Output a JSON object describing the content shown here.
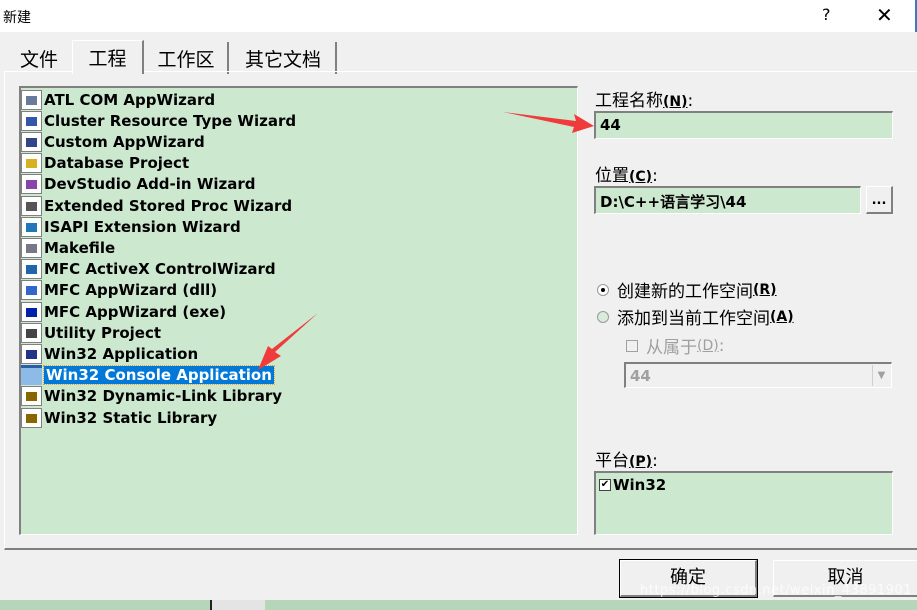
{
  "window": {
    "title": "新建",
    "help_label": "?",
    "close_label": "✕"
  },
  "tabs": [
    {
      "label": "文件",
      "active": false
    },
    {
      "label": "工程",
      "active": true
    },
    {
      "label": "工作区",
      "active": false
    },
    {
      "label": "其它文档",
      "active": false
    }
  ],
  "project_types": [
    {
      "label": "ATL COM AppWizard",
      "icon": "atl-com-icon"
    },
    {
      "label": "Cluster Resource Type Wizard",
      "icon": "cluster-icon"
    },
    {
      "label": "Custom AppWizard",
      "icon": "custom-wizard-icon"
    },
    {
      "label": "Database Project",
      "icon": "database-icon"
    },
    {
      "label": "DevStudio Add-in Wizard",
      "icon": "addin-icon"
    },
    {
      "label": "Extended Stored Proc Wizard",
      "icon": "stored-proc-icon"
    },
    {
      "label": "ISAPI Extension Wizard",
      "icon": "globe-icon"
    },
    {
      "label": "Makefile",
      "icon": "makefile-icon"
    },
    {
      "label": "MFC ActiveX ControlWizard",
      "icon": "activex-icon"
    },
    {
      "label": "MFC AppWizard (dll)",
      "icon": "mfc-dll-icon"
    },
    {
      "label": "MFC AppWizard (exe)",
      "icon": "mfc-exe-icon"
    },
    {
      "label": "Utility Project",
      "icon": "utility-icon"
    },
    {
      "label": "Win32 Application",
      "icon": "win32-app-icon"
    },
    {
      "label": "Win32 Console Application",
      "icon": "console-icon",
      "selected": true
    },
    {
      "label": "Win32 Dynamic-Link Library",
      "icon": "dll-icon"
    },
    {
      "label": "Win32 Static Library",
      "icon": "static-lib-icon"
    }
  ],
  "project_name": {
    "label": "工程名称",
    "accel": "(N)",
    "suffix": ":",
    "value": "44"
  },
  "location": {
    "label": "位置",
    "accel": "(C)",
    "suffix": ":",
    "value": "D:\\C++语言学习\\44",
    "browse_label": "..."
  },
  "workspace_options": {
    "create_new": {
      "label": "创建新的工作空间",
      "accel": "(R)",
      "checked": true
    },
    "add_to_current": {
      "label": "添加到当前工作空间",
      "accel": "(A)",
      "checked": false
    },
    "dependency": {
      "label": "从属于",
      "accel": "(D)",
      "suffix": ":",
      "checked": false,
      "enabled": false
    },
    "dependency_combo_value": "44"
  },
  "platforms": {
    "label": "平台",
    "accel": "(P)",
    "suffix": ":",
    "items": [
      {
        "label": "Win32",
        "checked": true
      }
    ]
  },
  "buttons": {
    "ok": "确定",
    "cancel": "取消"
  },
  "watermark": "https://blog.csdn.net/weixin_43891901",
  "colors": {
    "list_bg": "#cce8cf",
    "selection": "#0078d7",
    "annotation_arrow": "#ef3b3b"
  }
}
